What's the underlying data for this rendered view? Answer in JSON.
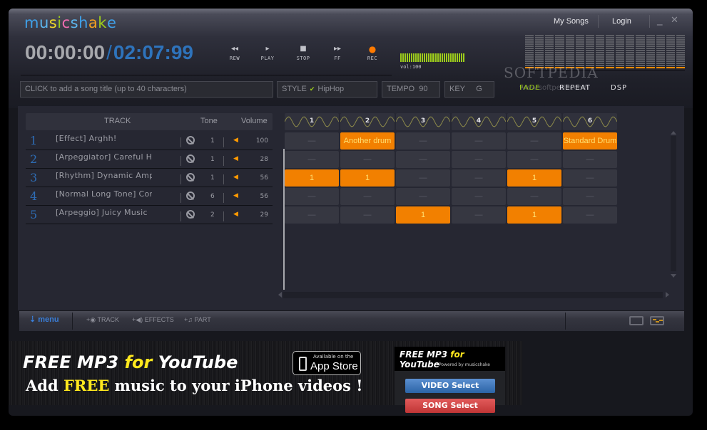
{
  "app": {
    "logo_letters": [
      {
        "ch": "m",
        "color": "#3fa0e8"
      },
      {
        "ch": "u",
        "color": "#5cb6ee"
      },
      {
        "ch": "s",
        "color": "#f0d82a"
      },
      {
        "ch": "i",
        "color": "#9ccc1c"
      },
      {
        "ch": "c",
        "color": "#f06cb0"
      },
      {
        "ch": "s",
        "color": "#5cb6ee"
      },
      {
        "ch": "h",
        "color": "#3fa0e8"
      },
      {
        "ch": "a",
        "color": "#f5a020"
      },
      {
        "ch": "k",
        "color": "#9ccc1c"
      },
      {
        "ch": "e",
        "color": "#3fa0e8"
      }
    ],
    "nav": {
      "my_songs": "My Songs",
      "login": "Login",
      "minimize": "_",
      "close": "✕"
    }
  },
  "player": {
    "elapsed": "00:00:00",
    "separator": "/",
    "total": "02:07:99",
    "controls": [
      {
        "id": "rew",
        "icon": "◂◂",
        "label": "REW"
      },
      {
        "id": "play",
        "icon": "▸",
        "label": "PLAY"
      },
      {
        "id": "stop",
        "icon": "■",
        "label": "STOP"
      },
      {
        "id": "ff",
        "icon": "▸▸",
        "label": "FF"
      },
      {
        "id": "rec",
        "icon": "●",
        "label": "REC"
      }
    ],
    "volume_label": "vol:100",
    "volume_percent": 100
  },
  "watermark": {
    "text": "SOFTPEDIA",
    "url": "www.softpedia.com"
  },
  "options": {
    "fade": "FADE",
    "repeat": "REPEAT",
    "dsp": "DSP"
  },
  "song": {
    "title_placeholder": "CLICK to add a song title (up to 40 characters)",
    "style_label": "STYLE",
    "style_value": "HipHop",
    "tempo_label": "TEMPO",
    "tempo_value": "90",
    "key_label": "KEY",
    "key_value": "G"
  },
  "tracks": {
    "headers": {
      "track": "TRACK",
      "tone": "Tone",
      "volume": "Volume"
    },
    "rows": [
      {
        "num": "1",
        "name": "[Effect] Arghh!",
        "tone": "1",
        "volume": "100"
      },
      {
        "num": "2",
        "name": "[Arpeggiator] Careful Hi",
        "tone": "1",
        "volume": "28"
      },
      {
        "num": "3",
        "name": "[Rhythm] Dynamic Ampe",
        "tone": "1",
        "volume": "56"
      },
      {
        "num": "4",
        "name": "[Normal Long Tone] Con",
        "tone": "6",
        "volume": "56"
      },
      {
        "num": "5",
        "name": "[Arpeggio] Juicy Music",
        "tone": "2",
        "volume": "29"
      }
    ]
  },
  "grid": {
    "columns": [
      "1",
      "2",
      "3",
      "4",
      "5",
      "6"
    ],
    "empty_mark": "—",
    "cells": [
      [
        "",
        "Another drum",
        "",
        "",
        "",
        "Standard Drum"
      ],
      [
        "",
        "",
        "",
        "",
        "",
        ""
      ],
      [
        "1",
        "1",
        "",
        "",
        "1",
        ""
      ],
      [
        "",
        "",
        "",
        "",
        "",
        ""
      ],
      [
        "",
        "",
        "1",
        "",
        "1",
        ""
      ]
    ]
  },
  "bottombar": {
    "menu": "menu",
    "track": "TRACK",
    "effects": "EFFECTS",
    "part": "PART"
  },
  "ad": {
    "line1_a": "FREE MP3 ",
    "line1_b": "for",
    "line1_c": " YouTube",
    "line2_a": "Add ",
    "line2_b": "FREE",
    "line2_c": " music to your iPhone videos !",
    "appstore_small": "Available on the",
    "appstore_big": "App Store",
    "side_title_a": "FREE MP3 ",
    "side_title_b": "for",
    "side_title_c": " YouTube",
    "powered": "Powered by musicshake",
    "video_btn": "VIDEO Select",
    "song_btn": "SONG Select"
  },
  "colors": {
    "accent_orange": "#f28000",
    "accent_blue": "#2e73bb",
    "accent_green": "#9ccc1c"
  }
}
